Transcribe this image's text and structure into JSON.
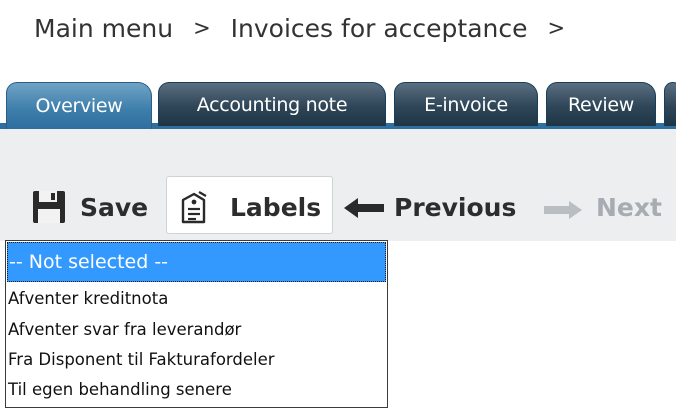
{
  "breadcrumb": {
    "items": [
      "Main menu",
      "Invoices for acceptance"
    ],
    "separator": ">"
  },
  "tabs": [
    {
      "label": "Overview",
      "active": true
    },
    {
      "label": "Accounting note",
      "active": false
    },
    {
      "label": "E-invoice",
      "active": false
    },
    {
      "label": "Review",
      "active": false
    }
  ],
  "toolbar": {
    "save_label": "Save",
    "labels_label": "Labels",
    "previous_label": "Previous",
    "next_label": "Next"
  },
  "dropdown": {
    "selected": "-- Not selected --",
    "options": [
      "Afventer kreditnota",
      "Afventer svar fra leverandør",
      "Fra Disponent til Fakturafordeler",
      "Til egen behandling senere"
    ]
  },
  "colors": {
    "tab_active": "#3c7daa",
    "tab_inactive": "#2f4658",
    "toolbar_bg": "#eceeef",
    "selection": "#3399ff"
  }
}
